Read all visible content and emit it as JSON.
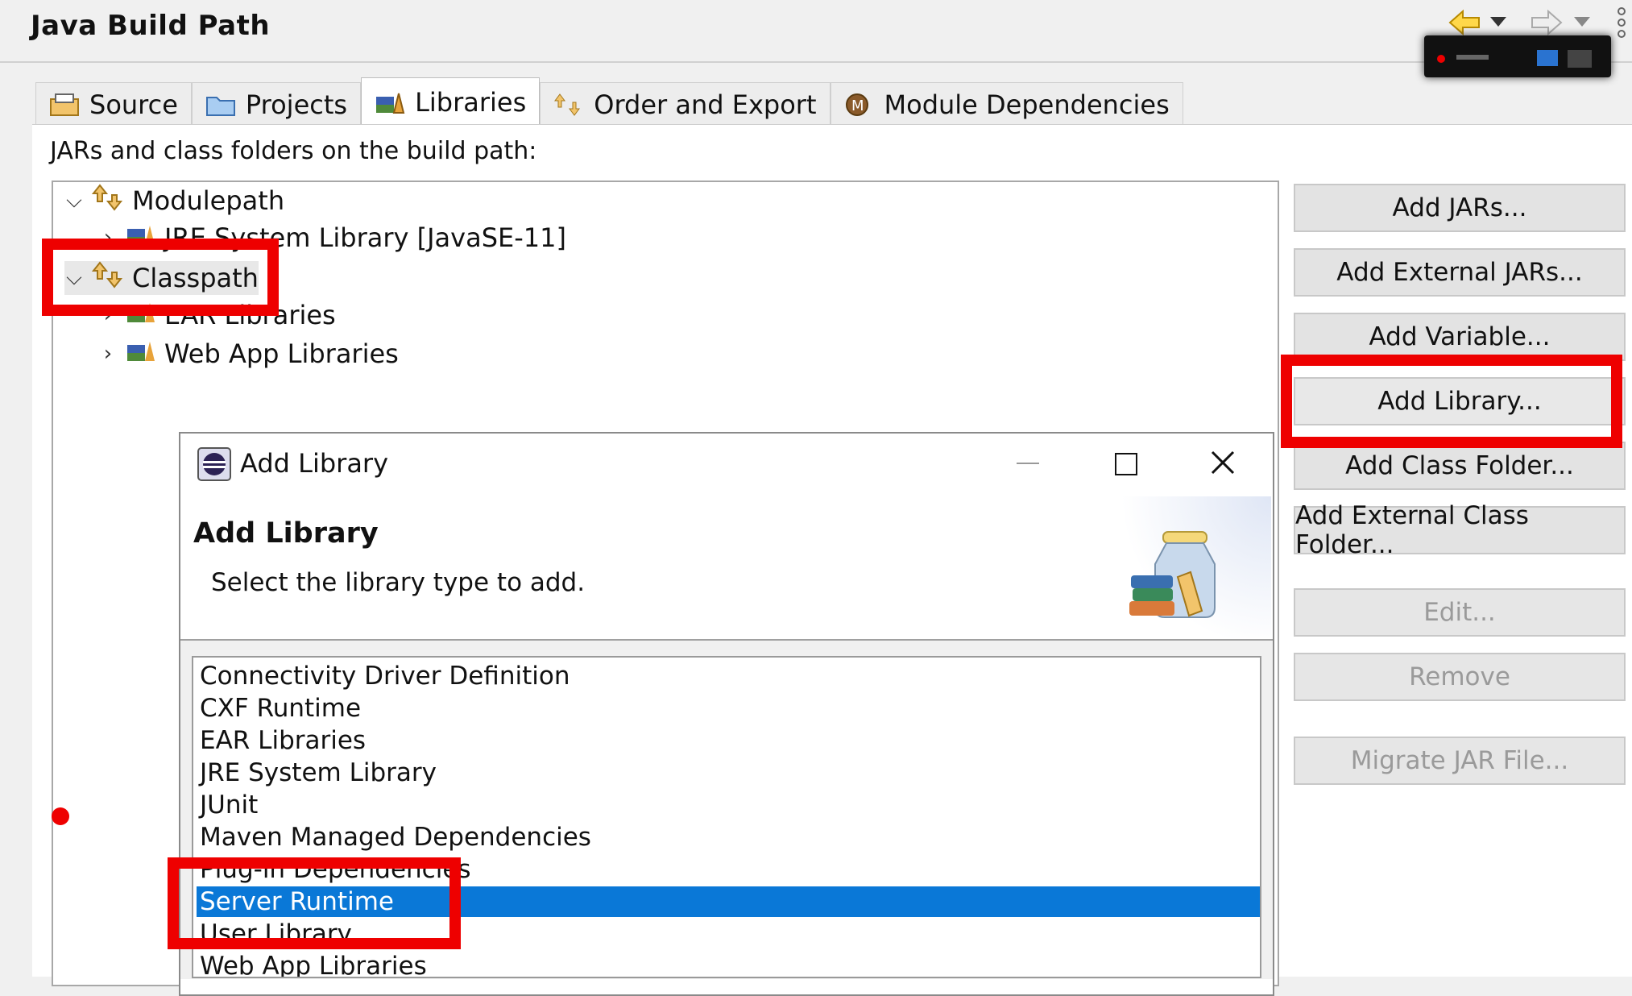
{
  "header": {
    "title": "Java Build Path"
  },
  "tabs": [
    {
      "label": "Source",
      "icon": "source-folder-icon",
      "active": false
    },
    {
      "label": "Projects",
      "icon": "projects-folder-icon",
      "active": false
    },
    {
      "label": "Libraries",
      "icon": "libraries-icon",
      "active": true
    },
    {
      "label": "Order and Export",
      "icon": "order-export-icon",
      "active": false
    },
    {
      "label": "Module Dependencies",
      "icon": "module-icon",
      "active": false
    }
  ],
  "build_path_label": "JARs and class folders on the build path:",
  "tree": {
    "modulepath": {
      "label": "Modulepath"
    },
    "jre": {
      "label": "JRE System Library [JavaSE-11]"
    },
    "classpath": {
      "label": "Classpath"
    },
    "ear": {
      "label": "EAR Libraries"
    },
    "webapp": {
      "label": "Web App Libraries"
    }
  },
  "buttons": {
    "add_jars": "Add JARs...",
    "add_external_jars": "Add External JARs...",
    "add_variable": "Add Variable...",
    "add_library": "Add Library...",
    "add_class_folder": "Add Class Folder...",
    "add_external_class_folder": "Add External Class Folder...",
    "edit": "Edit...",
    "remove": "Remove",
    "migrate_jar": "Migrate JAR File..."
  },
  "dialog": {
    "window_title": "Add Library",
    "heading": "Add Library",
    "description": "Select the library type to add.",
    "library_types": [
      "Connectivity Driver Definition",
      "CXF Runtime",
      "EAR Libraries",
      "JRE System Library",
      "JUnit",
      "Maven Managed Dependencies",
      "Plug-in Dependencies",
      "Server Runtime",
      "User Library",
      "Web App Libraries"
    ],
    "selected": "Server Runtime"
  },
  "colors": {
    "highlight": "#ee0000",
    "selection": "#0a78d7"
  }
}
